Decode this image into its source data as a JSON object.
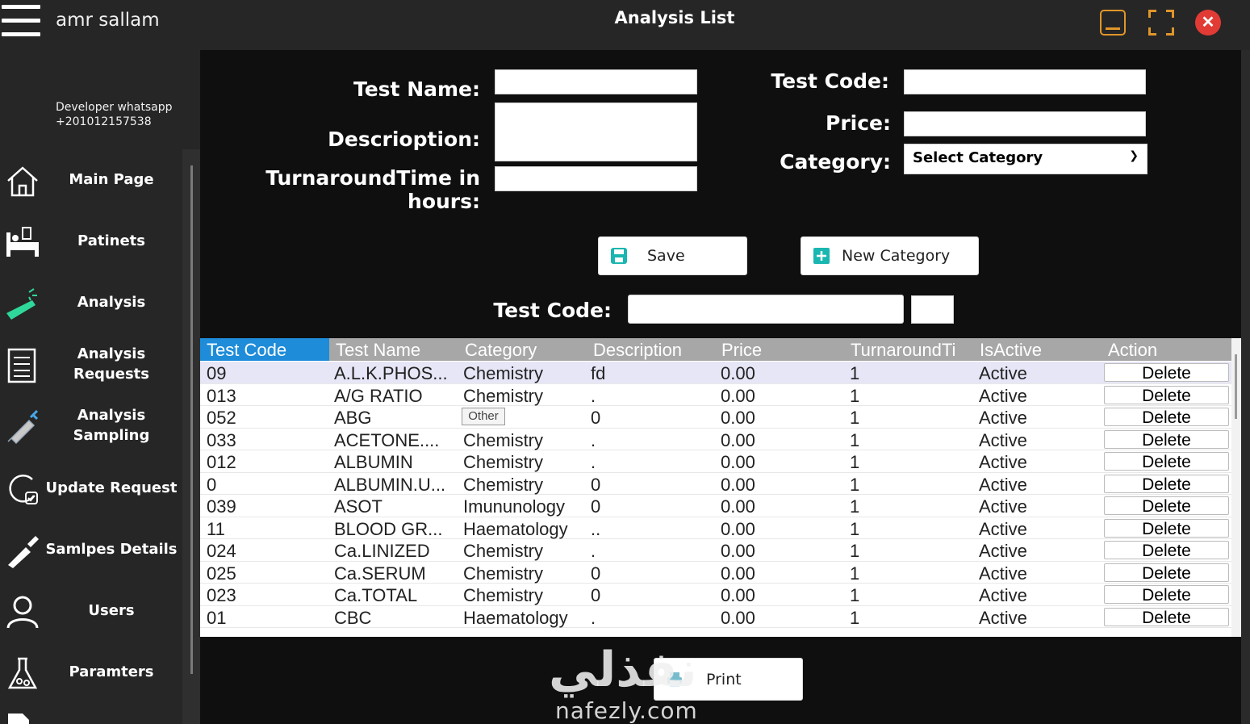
{
  "header": {
    "user_name": "amr sallam",
    "title": "Analysis List"
  },
  "developer": {
    "line1": "Developer whatsapp",
    "line2": "+201012157538"
  },
  "sidebar": {
    "items": [
      {
        "label": "Main Page",
        "icon": "home-icon"
      },
      {
        "label": "Patinets",
        "icon": "hospital-bed-icon"
      },
      {
        "label": "Analysis",
        "icon": "test-tube-icon"
      },
      {
        "label": "Analysis\nRequests",
        "icon": "document-list-icon"
      },
      {
        "label": "Analysis\nSampling",
        "icon": "syringe-icon"
      },
      {
        "label": "Update Request",
        "icon": "refresh-check-icon"
      },
      {
        "label": "Samlpes Details",
        "icon": "dropper-icon"
      },
      {
        "label": "Users",
        "icon": "users-icon"
      },
      {
        "label": "Paramters",
        "icon": "flask-icon"
      }
    ]
  },
  "form": {
    "test_name_label": "Test Name:",
    "description_label": "Descrioption:",
    "turnaround_label": "TurnaroundTime in hours:",
    "test_code_label": "Test Code:",
    "price_label": "Price:",
    "category_label": "Category:",
    "category_value": "Select Category",
    "save_label": "Save",
    "new_category_label": "New Category",
    "search_code_label": "Test Code:"
  },
  "grid": {
    "columns": [
      "Test Code",
      "Test Name",
      "Category",
      "Description",
      "Price",
      "TurnaroundTi",
      "IsActive",
      "Action"
    ],
    "rows": [
      {
        "code": "09",
        "name": "A.L.K.PHOS...",
        "category": "Chemistry",
        "description": "fd",
        "price": "0.00",
        "tat": "1",
        "active": "Active",
        "action": "Delete"
      },
      {
        "code": "013",
        "name": "A/G RATIO",
        "category": "Chemistry",
        "description": ".",
        "price": "0.00",
        "tat": "1",
        "active": "Active",
        "action": "Delete"
      },
      {
        "code": "052",
        "name": "ABG",
        "category": "",
        "description": "0",
        "price": "0.00",
        "tat": "1",
        "active": "Active",
        "action": "Delete"
      },
      {
        "code": "033",
        "name": "ACETONE....",
        "category": "Chemistry",
        "description": ".",
        "price": "0.00",
        "tat": "1",
        "active": "Active",
        "action": "Delete"
      },
      {
        "code": "012",
        "name": "ALBUMIN",
        "category": "Chemistry",
        "description": ".",
        "price": "0.00",
        "tat": "1",
        "active": "Active",
        "action": "Delete"
      },
      {
        "code": "0",
        "name": "ALBUMIN.U...",
        "category": "Chemistry",
        "description": "0",
        "price": "0.00",
        "tat": "1",
        "active": "Active",
        "action": "Delete"
      },
      {
        "code": "039",
        "name": "ASOT",
        "category": "Imununology",
        "description": "0",
        "price": "0.00",
        "tat": "1",
        "active": "Active",
        "action": "Delete"
      },
      {
        "code": "11",
        "name": "BLOOD GR...",
        "category": "Haematology",
        "description": "..",
        "price": "0.00",
        "tat": "1",
        "active": "Active",
        "action": "Delete"
      },
      {
        "code": "024",
        "name": "Ca.LINIZED",
        "category": "Chemistry",
        "description": ".",
        "price": "0.00",
        "tat": "1",
        "active": "Active",
        "action": "Delete"
      },
      {
        "code": "025",
        "name": "Ca.SERUM",
        "category": "Chemistry",
        "description": "0",
        "price": "0.00",
        "tat": "1",
        "active": "Active",
        "action": "Delete"
      },
      {
        "code": "023",
        "name": "Ca.TOTAL",
        "category": "Chemistry",
        "description": "0",
        "price": "0.00",
        "tat": "1",
        "active": "Active",
        "action": "Delete"
      },
      {
        "code": "01",
        "name": "CBC",
        "category": "Haematology",
        "description": ".",
        "price": "0.00",
        "tat": "1",
        "active": "Active",
        "action": "Delete"
      }
    ],
    "tooltip": "Other"
  },
  "print_label": "Print",
  "watermark": {
    "arabic": "نفذلي",
    "latin": "nafezly.com"
  },
  "colors": {
    "accent_orange": "#e0962a",
    "close_red": "#e23a35",
    "selected_header_blue": "#1e8cd9",
    "save_icon_teal": "#1ab6b0"
  }
}
